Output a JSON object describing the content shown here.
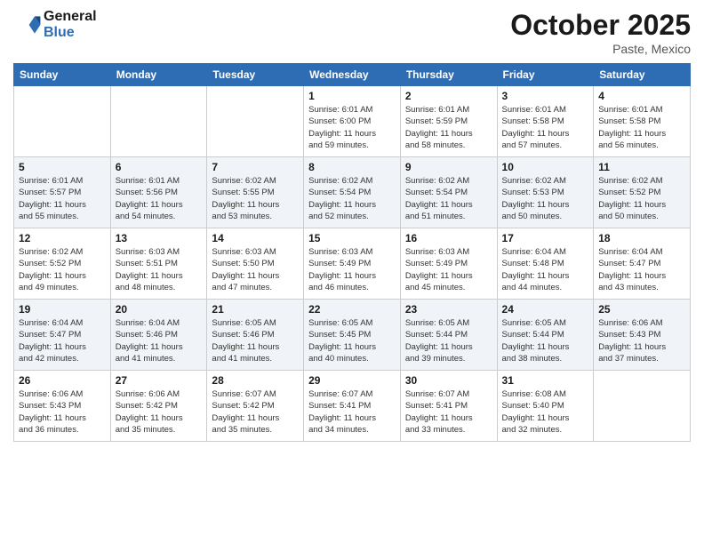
{
  "header": {
    "logo_line1": "General",
    "logo_line2": "Blue",
    "month": "October 2025",
    "location": "Paste, Mexico"
  },
  "weekdays": [
    "Sunday",
    "Monday",
    "Tuesday",
    "Wednesday",
    "Thursday",
    "Friday",
    "Saturday"
  ],
  "weeks": [
    [
      {
        "day": "",
        "info": ""
      },
      {
        "day": "",
        "info": ""
      },
      {
        "day": "",
        "info": ""
      },
      {
        "day": "1",
        "info": "Sunrise: 6:01 AM\nSunset: 6:00 PM\nDaylight: 11 hours\nand 59 minutes."
      },
      {
        "day": "2",
        "info": "Sunrise: 6:01 AM\nSunset: 5:59 PM\nDaylight: 11 hours\nand 58 minutes."
      },
      {
        "day": "3",
        "info": "Sunrise: 6:01 AM\nSunset: 5:58 PM\nDaylight: 11 hours\nand 57 minutes."
      },
      {
        "day": "4",
        "info": "Sunrise: 6:01 AM\nSunset: 5:58 PM\nDaylight: 11 hours\nand 56 minutes."
      }
    ],
    [
      {
        "day": "5",
        "info": "Sunrise: 6:01 AM\nSunset: 5:57 PM\nDaylight: 11 hours\nand 55 minutes."
      },
      {
        "day": "6",
        "info": "Sunrise: 6:01 AM\nSunset: 5:56 PM\nDaylight: 11 hours\nand 54 minutes."
      },
      {
        "day": "7",
        "info": "Sunrise: 6:02 AM\nSunset: 5:55 PM\nDaylight: 11 hours\nand 53 minutes."
      },
      {
        "day": "8",
        "info": "Sunrise: 6:02 AM\nSunset: 5:54 PM\nDaylight: 11 hours\nand 52 minutes."
      },
      {
        "day": "9",
        "info": "Sunrise: 6:02 AM\nSunset: 5:54 PM\nDaylight: 11 hours\nand 51 minutes."
      },
      {
        "day": "10",
        "info": "Sunrise: 6:02 AM\nSunset: 5:53 PM\nDaylight: 11 hours\nand 50 minutes."
      },
      {
        "day": "11",
        "info": "Sunrise: 6:02 AM\nSunset: 5:52 PM\nDaylight: 11 hours\nand 50 minutes."
      }
    ],
    [
      {
        "day": "12",
        "info": "Sunrise: 6:02 AM\nSunset: 5:52 PM\nDaylight: 11 hours\nand 49 minutes."
      },
      {
        "day": "13",
        "info": "Sunrise: 6:03 AM\nSunset: 5:51 PM\nDaylight: 11 hours\nand 48 minutes."
      },
      {
        "day": "14",
        "info": "Sunrise: 6:03 AM\nSunset: 5:50 PM\nDaylight: 11 hours\nand 47 minutes."
      },
      {
        "day": "15",
        "info": "Sunrise: 6:03 AM\nSunset: 5:49 PM\nDaylight: 11 hours\nand 46 minutes."
      },
      {
        "day": "16",
        "info": "Sunrise: 6:03 AM\nSunset: 5:49 PM\nDaylight: 11 hours\nand 45 minutes."
      },
      {
        "day": "17",
        "info": "Sunrise: 6:04 AM\nSunset: 5:48 PM\nDaylight: 11 hours\nand 44 minutes."
      },
      {
        "day": "18",
        "info": "Sunrise: 6:04 AM\nSunset: 5:47 PM\nDaylight: 11 hours\nand 43 minutes."
      }
    ],
    [
      {
        "day": "19",
        "info": "Sunrise: 6:04 AM\nSunset: 5:47 PM\nDaylight: 11 hours\nand 42 minutes."
      },
      {
        "day": "20",
        "info": "Sunrise: 6:04 AM\nSunset: 5:46 PM\nDaylight: 11 hours\nand 41 minutes."
      },
      {
        "day": "21",
        "info": "Sunrise: 6:05 AM\nSunset: 5:46 PM\nDaylight: 11 hours\nand 41 minutes."
      },
      {
        "day": "22",
        "info": "Sunrise: 6:05 AM\nSunset: 5:45 PM\nDaylight: 11 hours\nand 40 minutes."
      },
      {
        "day": "23",
        "info": "Sunrise: 6:05 AM\nSunset: 5:44 PM\nDaylight: 11 hours\nand 39 minutes."
      },
      {
        "day": "24",
        "info": "Sunrise: 6:05 AM\nSunset: 5:44 PM\nDaylight: 11 hours\nand 38 minutes."
      },
      {
        "day": "25",
        "info": "Sunrise: 6:06 AM\nSunset: 5:43 PM\nDaylight: 11 hours\nand 37 minutes."
      }
    ],
    [
      {
        "day": "26",
        "info": "Sunrise: 6:06 AM\nSunset: 5:43 PM\nDaylight: 11 hours\nand 36 minutes."
      },
      {
        "day": "27",
        "info": "Sunrise: 6:06 AM\nSunset: 5:42 PM\nDaylight: 11 hours\nand 35 minutes."
      },
      {
        "day": "28",
        "info": "Sunrise: 6:07 AM\nSunset: 5:42 PM\nDaylight: 11 hours\nand 35 minutes."
      },
      {
        "day": "29",
        "info": "Sunrise: 6:07 AM\nSunset: 5:41 PM\nDaylight: 11 hours\nand 34 minutes."
      },
      {
        "day": "30",
        "info": "Sunrise: 6:07 AM\nSunset: 5:41 PM\nDaylight: 11 hours\nand 33 minutes."
      },
      {
        "day": "31",
        "info": "Sunrise: 6:08 AM\nSunset: 5:40 PM\nDaylight: 11 hours\nand 32 minutes."
      },
      {
        "day": "",
        "info": ""
      }
    ]
  ]
}
